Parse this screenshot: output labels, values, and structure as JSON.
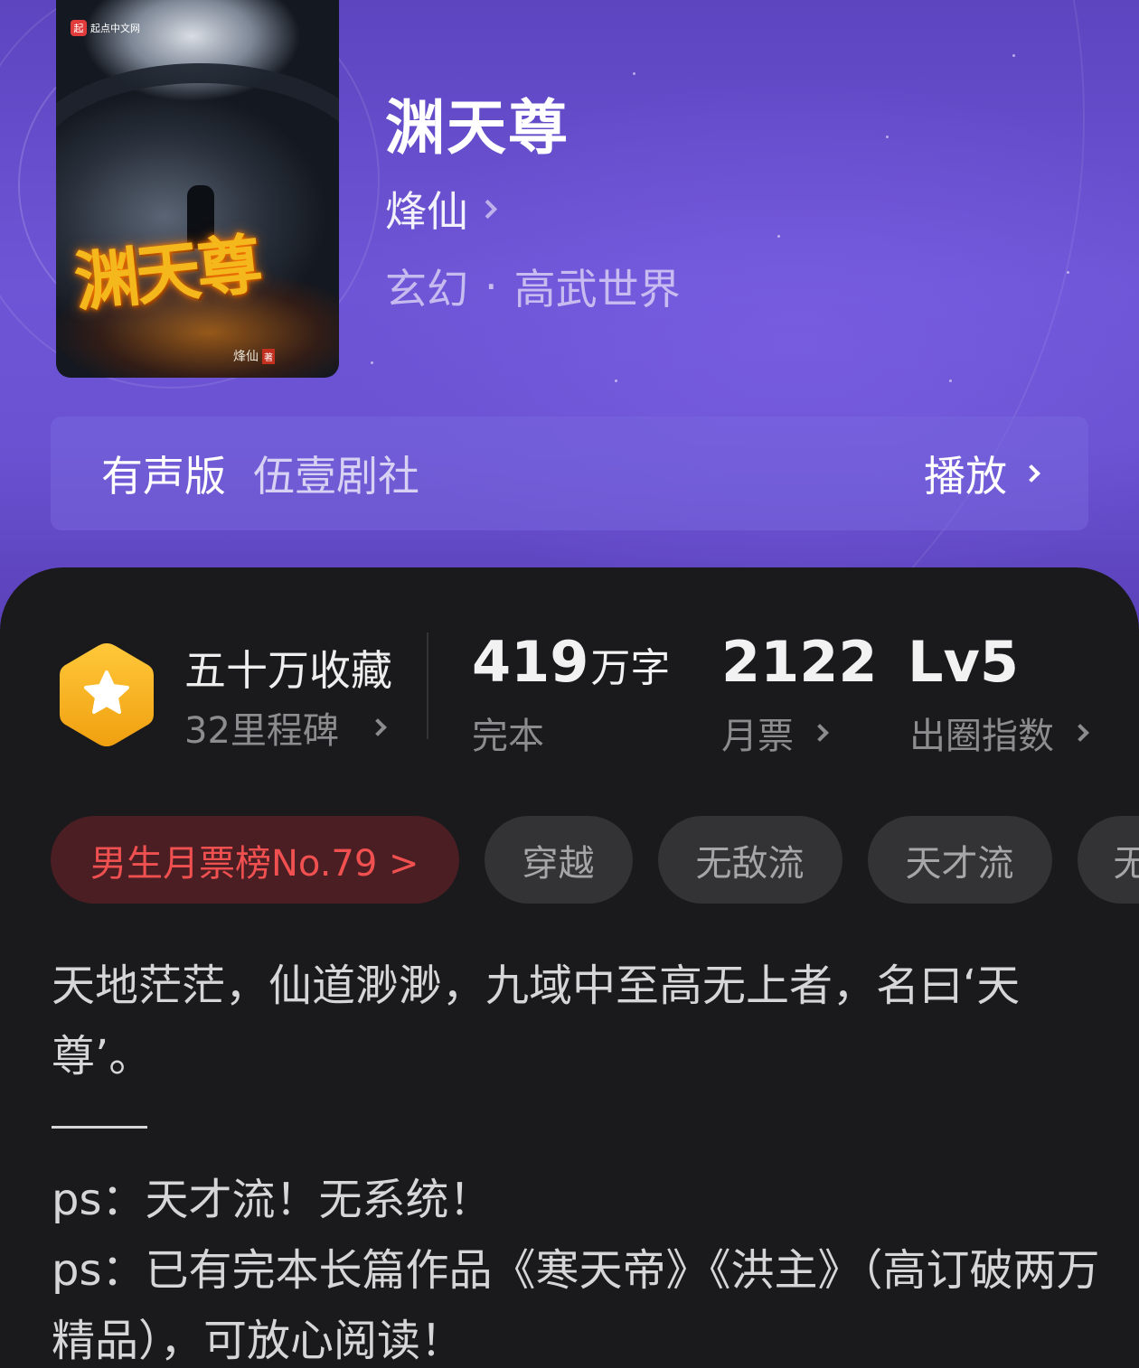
{
  "book": {
    "title": "渊天尊",
    "author": "烽仙",
    "genre": "玄幻",
    "subgenre": "高武世界",
    "genre_separator": "·",
    "cover": {
      "publisher_logo_text": "起点中文网",
      "publisher_logo_mark": "起",
      "title_art": "渊天尊",
      "author_art": "烽仙",
      "author_seal": "著"
    }
  },
  "audio": {
    "label": "有声版",
    "studio": "伍壹剧社",
    "play_label": "播放"
  },
  "stats": {
    "collection_title": "五十万收藏",
    "milestone_label": "32里程碑",
    "word_count_value": "419",
    "word_count_unit": "万字",
    "status_label": "完本",
    "monthly_ticket_value": "2122",
    "monthly_ticket_label": "月票",
    "influence_value": "Lv5",
    "influence_label": "出圈指数"
  },
  "tags": {
    "rank": "男生月票榜No.79 >",
    "items": [
      "穿越",
      "无敌流",
      "天才流",
      "无"
    ]
  },
  "description": {
    "line1": "天地茫茫，仙道渺渺，九域中至高无上者，名曰‘天尊’。",
    "line2": "ps：天才流！无系统！",
    "line3": "ps：已有完本长篇作品《寒天帝》《洪主》（高订破两万精品），可放心阅读！"
  },
  "colors": {
    "header_purple": "#6d55d6",
    "panel_dark": "#1a1a1c",
    "badge_orange": "#f6b41e",
    "rank_red": "#f05050"
  }
}
